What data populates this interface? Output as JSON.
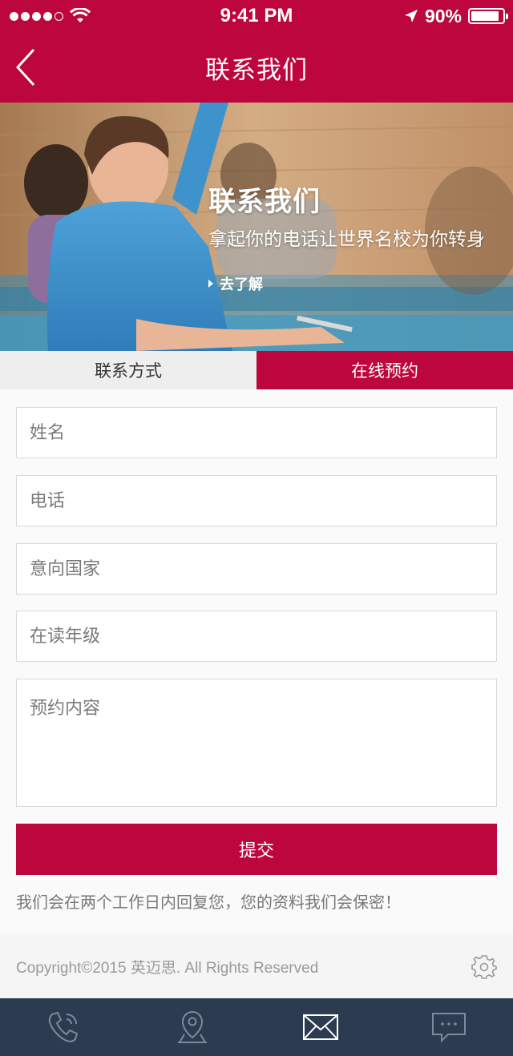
{
  "status_bar": {
    "time": "9:41 PM",
    "battery": "90%",
    "battery_level": 0.9,
    "signal_icon": "signal-dots-icon",
    "wifi_icon": "wifi-icon",
    "location_icon": "location-arrow-icon"
  },
  "nav": {
    "title": "联系我们",
    "back_icon": "chevron-left-icon"
  },
  "hero": {
    "title": "联系我们",
    "subtitle": "拿起你的电话让世界名校为你转身",
    "link_label": "去了解"
  },
  "tabs": [
    {
      "label": "联系方式",
      "active": false
    },
    {
      "label": "在线预约",
      "active": true
    }
  ],
  "form": {
    "name_placeholder": "姓名",
    "phone_placeholder": "电话",
    "country_placeholder": "意向国家",
    "grade_placeholder": "在读年级",
    "content_placeholder": "预约内容",
    "submit_label": "提交",
    "notice": "我们会在两个工作日内回复您，您的资料我们会保密！"
  },
  "footer": {
    "copyright": "Copyright©2015 英迈思. All Rights Reserved",
    "settings_icon": "gear-icon"
  },
  "bottom_nav": [
    {
      "icon": "phone-icon"
    },
    {
      "icon": "map-pin-icon"
    },
    {
      "icon": "mail-icon"
    },
    {
      "icon": "chat-icon"
    }
  ],
  "colors": {
    "brand": "#bd063e",
    "bottom_bar": "#2c3b50"
  }
}
